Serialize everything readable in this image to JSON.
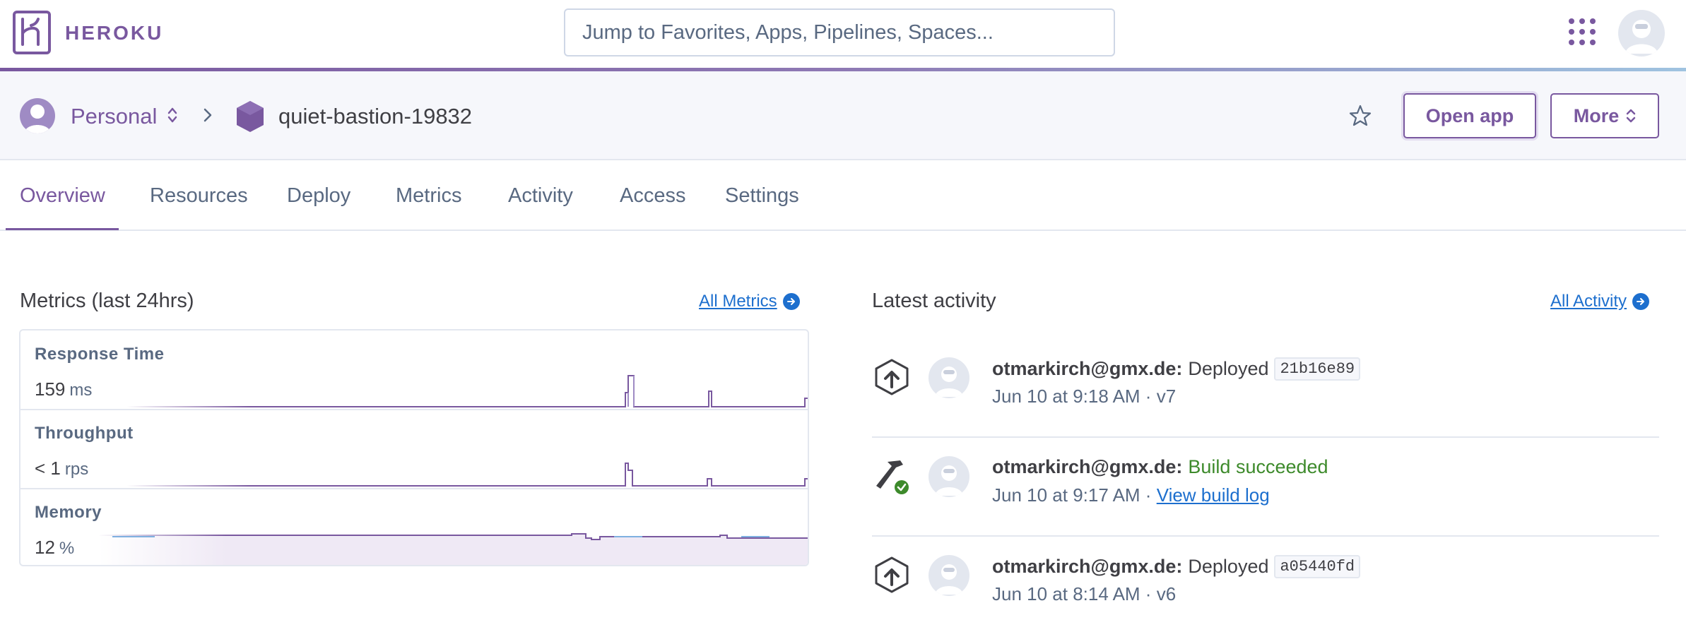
{
  "topbar": {
    "brand": "HEROKU",
    "search_placeholder": "Jump to Favorites, Apps, Pipelines, Spaces..."
  },
  "app_header": {
    "account_label": "Personal",
    "app_name": "quiet-bastion-19832",
    "open_app_label": "Open app",
    "more_label": "More"
  },
  "tabs": [
    {
      "label": "Overview",
      "active": true
    },
    {
      "label": "Resources"
    },
    {
      "label": "Deploy"
    },
    {
      "label": "Metrics"
    },
    {
      "label": "Activity"
    },
    {
      "label": "Access"
    },
    {
      "label": "Settings"
    }
  ],
  "metrics": {
    "title": "Metrics (last 24hrs)",
    "all_link": "All Metrics",
    "rows": [
      {
        "label": "Response Time",
        "value": "159",
        "unit": "ms"
      },
      {
        "label": "Throughput",
        "value": "< 1",
        "unit": "rps"
      },
      {
        "label": "Memory",
        "value": "12",
        "unit": "%"
      }
    ]
  },
  "activity": {
    "title": "Latest activity",
    "all_link": "All Activity",
    "items": [
      {
        "user": "otmarkirch@gmx.de:",
        "action": "Deployed",
        "commit": "21b16e89",
        "time": "Jun 10 at 9:18 AM · v7"
      },
      {
        "user": "otmarkirch@gmx.de:",
        "action": "Build succeeded",
        "time": "Jun 10 at 9:17 AM · ",
        "link": "View build log"
      },
      {
        "user": "otmarkirch@gmx.de:",
        "action": "Deployed",
        "commit": "a05440fd",
        "time": "Jun 10 at 8:14 AM · v6"
      }
    ]
  },
  "colors": {
    "brand": "#79589f",
    "link": "#1d6fce",
    "success": "#3d8a2b",
    "text": "#3f3f44",
    "muted": "#596981"
  },
  "icons": [
    "heroku-logo-icon",
    "apps-grid-icon",
    "user-avatar-icon",
    "personal-avatar-icon",
    "chevron-updown-icon",
    "chevron-right-icon",
    "app-hexagon-icon",
    "star-icon",
    "arrow-circle-right-icon",
    "deploy-upload-icon",
    "build-hammer-icon",
    "success-check-icon"
  ]
}
